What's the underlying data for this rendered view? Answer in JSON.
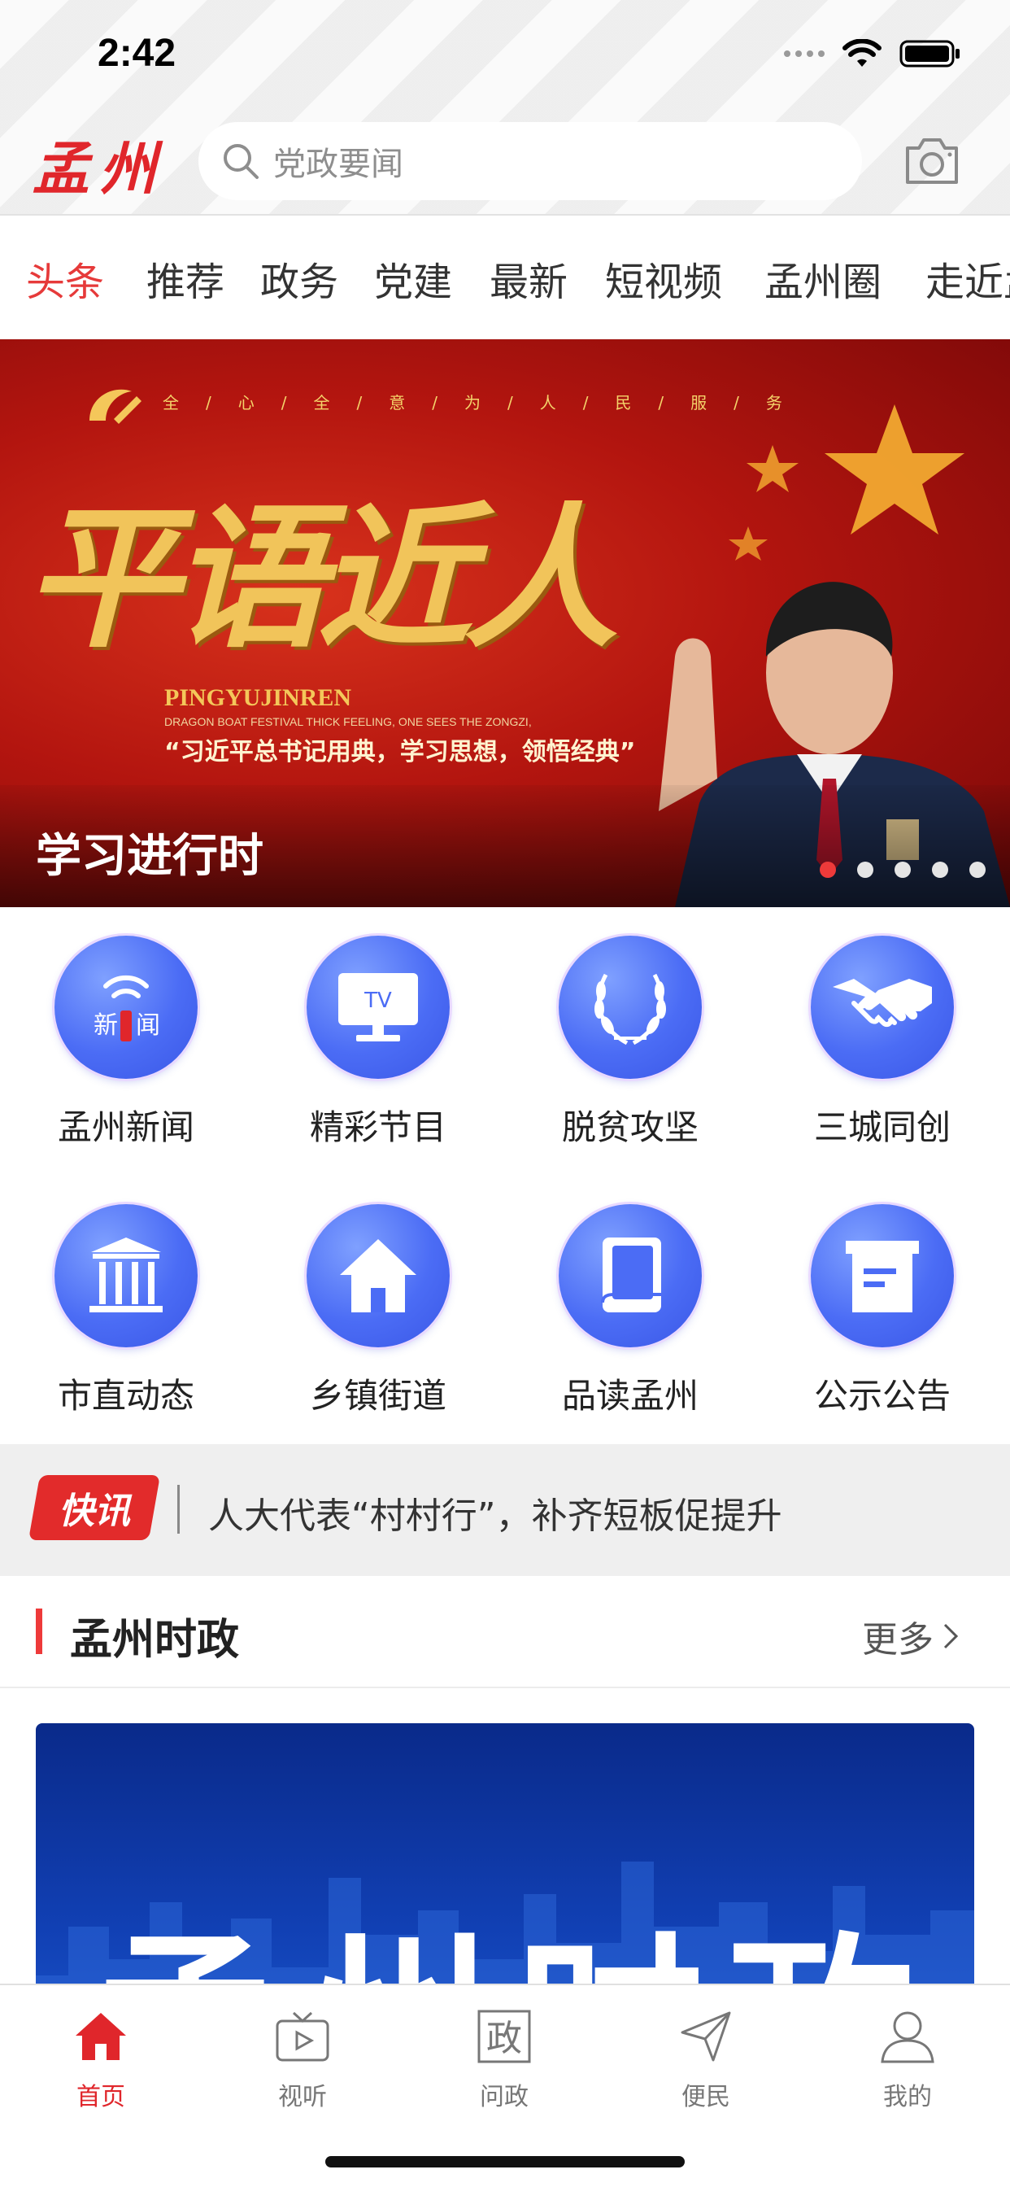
{
  "status_bar": {
    "time": "2:42"
  },
  "header": {
    "logo": "孟州",
    "search_placeholder": "党政要闻"
  },
  "tabs": [
    "头条",
    "推荐",
    "政务",
    "党建",
    "最新",
    "短视频",
    "孟州圈",
    "走近孟州"
  ],
  "active_tab": "头条",
  "banner": {
    "strap": "全/心/全/意/为/人/民/服/务",
    "calligraphy": "平语近人",
    "english_title": "PINGYUJINREN",
    "english_sub": "DRAGON BOAT FESTIVAL THICK FEELING, ONE SEES THE ZONGZI,",
    "quote": "“习近平总书记用典，学习思想，领悟经典”",
    "caption": "学习进行时",
    "page_count": 5,
    "current_page": 1
  },
  "grid": [
    {
      "label": "孟州新闻",
      "icon": "news-broadcast-icon",
      "glyph_left": "新",
      "glyph_right": "闻"
    },
    {
      "label": "精彩节目",
      "icon": "tv-icon",
      "glyph": "TV"
    },
    {
      "label": "脱贫攻坚",
      "icon": "wheat-wreath-icon"
    },
    {
      "label": "三城同创",
      "icon": "handshake-icon"
    },
    {
      "label": "市直动态",
      "icon": "government-building-icon"
    },
    {
      "label": "乡镇街道",
      "icon": "house-icon"
    },
    {
      "label": "品读孟州",
      "icon": "book-icon"
    },
    {
      "label": "公示公告",
      "icon": "notice-board-icon"
    }
  ],
  "flash": {
    "badge": "快讯",
    "text": "人大代表“村村行”，补齐短板促提升"
  },
  "section": {
    "title": "孟州时政",
    "more": "更多"
  },
  "feature": {
    "text": "孟州时政"
  },
  "tabbar": [
    {
      "label": "首页",
      "icon": "home-icon",
      "active": true
    },
    {
      "label": "视听",
      "icon": "tv-play-icon",
      "active": false
    },
    {
      "label": "问政",
      "icon": "wenzheng-icon",
      "glyph": "政",
      "active": false
    },
    {
      "label": "便民",
      "icon": "paper-plane-icon",
      "active": false
    },
    {
      "label": "我的",
      "icon": "profile-icon",
      "active": false
    }
  ],
  "colors": {
    "accent": "#e0262b",
    "grid_icon": "#4b6cf5",
    "flash_bg": "#efefef"
  }
}
